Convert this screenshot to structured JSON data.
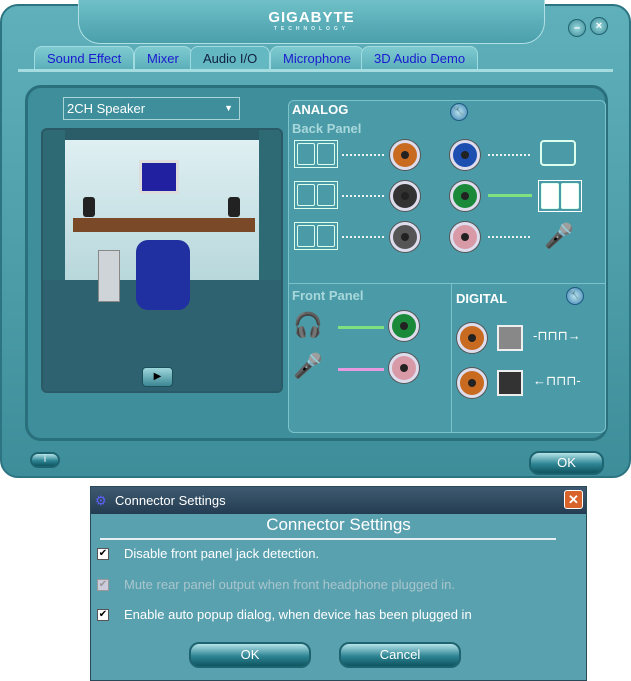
{
  "app": {
    "brand": "GIGABYTE",
    "brand_sub": "TECHNOLOGY"
  },
  "tabs": [
    {
      "label": "Sound Effect"
    },
    {
      "label": "Mixer"
    },
    {
      "label": "Audio I/O",
      "active": true
    },
    {
      "label": "Microphone"
    },
    {
      "label": "3D Audio Demo"
    }
  ],
  "speaker_select": {
    "value": "2CH Speaker"
  },
  "analog": {
    "title": "ANALOG",
    "back_panel": "Back Panel",
    "front_panel": "Front Panel",
    "back_jacks": [
      {
        "color": "#c86a20"
      },
      {
        "color": "#333333"
      },
      {
        "color": "#555555"
      },
      {
        "color": "#1c4fb0"
      },
      {
        "color": "#1a8a3a"
      },
      {
        "color": "#d89aa6"
      }
    ],
    "front_jacks": [
      {
        "color": "#1a8a3a",
        "device": "headphone-icon"
      },
      {
        "color": "#d89aa6",
        "device": "microphone-icon"
      }
    ]
  },
  "digital": {
    "title": "DIGITAL"
  },
  "footer": {
    "ok_label": "OK"
  },
  "dialog": {
    "title": "Connector Settings",
    "heading": "Connector Settings",
    "options": [
      {
        "label": "Disable front panel jack detection.",
        "checked": true,
        "enabled": true
      },
      {
        "label": "Mute rear panel output when front headphone plugged in.",
        "checked": true,
        "enabled": false
      },
      {
        "label": "Enable auto popup dialog, when device has been plugged in",
        "checked": true,
        "enabled": true
      }
    ],
    "ok_label": "OK",
    "cancel_label": "Cancel",
    "check": "✔"
  }
}
